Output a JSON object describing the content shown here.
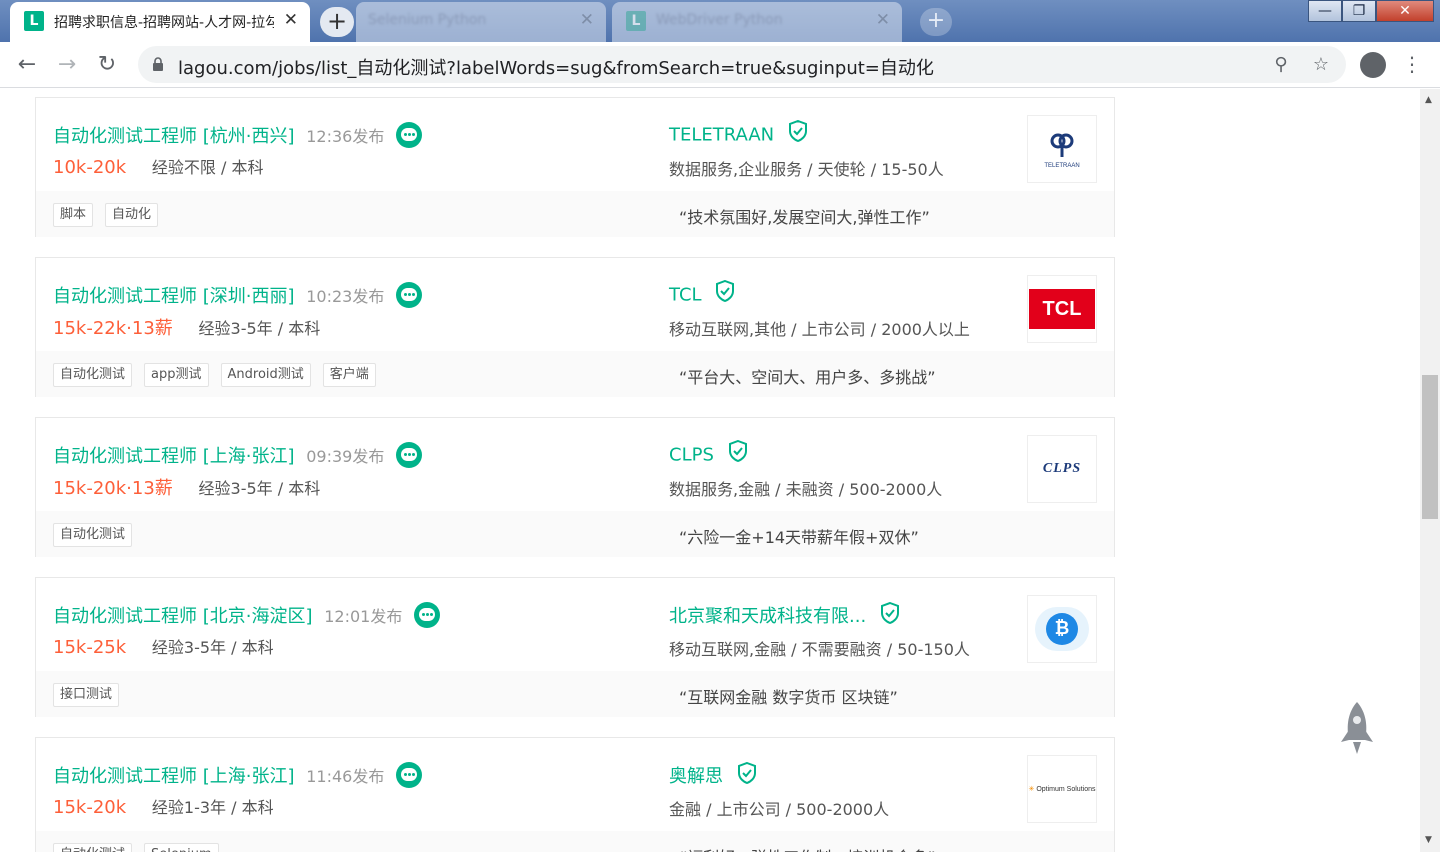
{
  "browser": {
    "active_tab": {
      "favicon": "L",
      "title": "招聘求职信息-招聘网站-人才网-拉勾",
      "close": "✕"
    },
    "bg_tabs": [
      {
        "title": "Selenium Python",
        "close": "✕"
      },
      {
        "title": "WebDriver Python",
        "close": "✕"
      }
    ],
    "new_tab": "+",
    "window_buttons": {
      "minimize": "—",
      "maximize": "❐",
      "close": "✕"
    },
    "back": "←",
    "forward": "→",
    "reload": "↻",
    "url": "lagou.com/jobs/list_自动化测试?labelWords=sug&fromSearch=true&suginput=自动化",
    "search_icon": "⚲",
    "star_icon": "☆",
    "menu": "⋮"
  },
  "jobs": [
    {
      "title": "自动化测试工程师 [杭州·西兴]",
      "time": "12:36发布",
      "salary": "10k-20k",
      "requirements": "经验不限 / 本科",
      "tags": [
        "脚本",
        "自动化"
      ],
      "company": "TELETRAAN",
      "industry": "数据服务,企业服务 / 天使轮 / 15-50人",
      "advantage": "“技术氛围好,发展空间大,弹性工作”",
      "logo_text": "TELETRAAN"
    },
    {
      "title": "自动化测试工程师 [深圳·西丽]",
      "time": "10:23发布",
      "salary": "15k-22k·13薪",
      "requirements": "经验3-5年 / 本科",
      "tags": [
        "自动化测试",
        "app测试",
        "Android测试",
        "客户端"
      ],
      "company": "TCL",
      "industry": "移动互联网,其他 / 上市公司 / 2000人以上",
      "advantage": "“平台大、空间大、用户多、多挑战”",
      "logo_text": "TCL"
    },
    {
      "title": "自动化测试工程师 [上海·张江]",
      "time": "09:39发布",
      "salary": "15k-20k·13薪",
      "requirements": "经验3-5年 / 本科",
      "tags": [
        "自动化测试"
      ],
      "company": "CLPS",
      "industry": "数据服务,金融 / 未融资 / 500-2000人",
      "advantage": "“六险一金+14天带薪年假+双休”",
      "logo_text": "CLPS"
    },
    {
      "title": "自动化测试工程师 [北京·海淀区]",
      "time": "12:01发布",
      "salary": "15k-25k",
      "requirements": "经验3-5年 / 本科",
      "tags": [
        "接口测试"
      ],
      "company": "北京聚和天成科技有限...",
      "industry": "移动互联网,金融 / 不需要融资 / 50-150人",
      "advantage": "“互联网金融 数字货币 区块链”",
      "logo_text": "₿"
    },
    {
      "title": "自动化测试工程师 [上海·张江]",
      "time": "11:46发布",
      "salary": "15k-20k",
      "requirements": "经验1-3年 / 本科",
      "tags": [
        "自动化测试",
        "Selenium"
      ],
      "company": "奥解思",
      "industry": "金融 / 上市公司 / 500-2000人",
      "advantage": "“福利好、弹性工作制、培训机会多”",
      "logo_text": "Optimum Solutions"
    }
  ],
  "colors": {
    "brand": "#00b38a",
    "salary": "#fd5f39",
    "tcl_red": "#e2001a"
  }
}
